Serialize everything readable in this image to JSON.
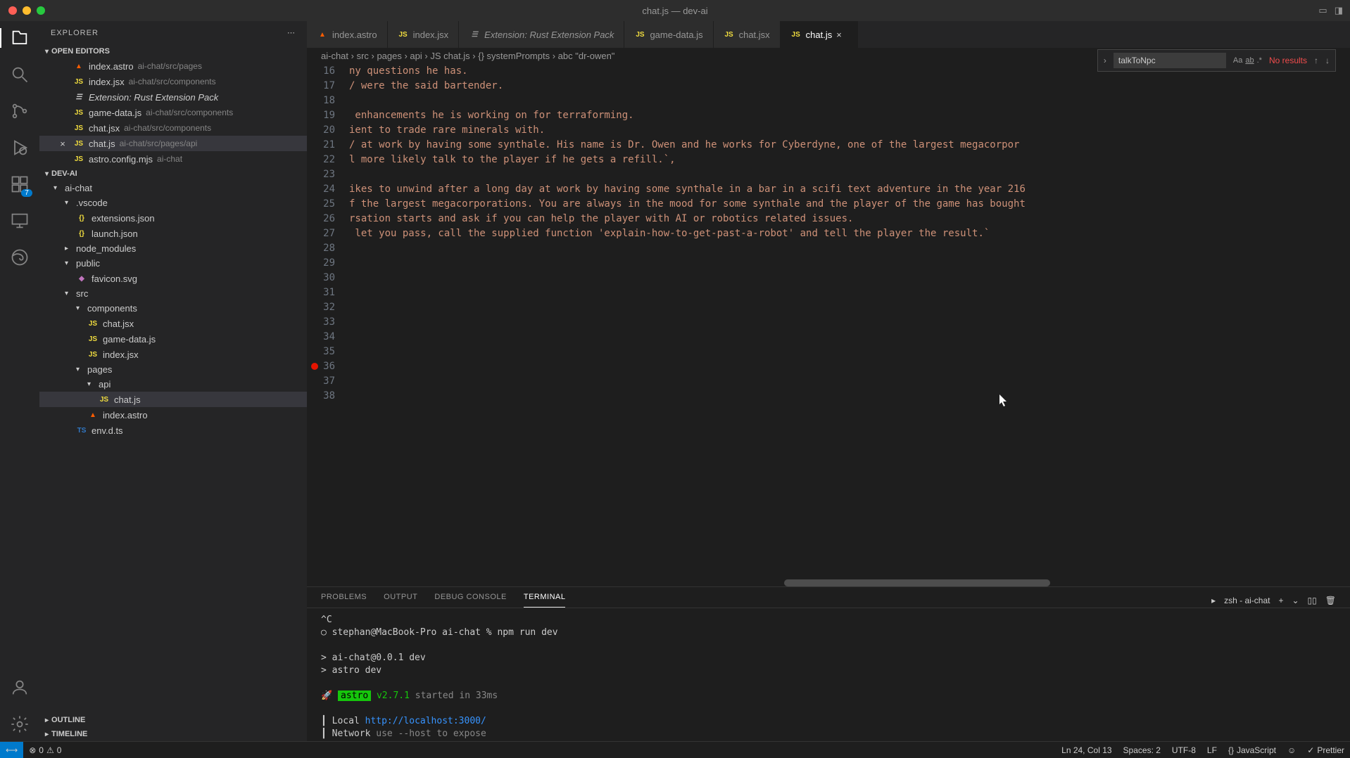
{
  "window": {
    "title": "chat.js — dev-ai"
  },
  "sidebar": {
    "title": "EXPLORER",
    "sections": {
      "openEditors": {
        "label": "OPEN EDITORS",
        "items": [
          {
            "icon": "astro",
            "name": "index.astro",
            "path": "ai-chat/src/pages"
          },
          {
            "icon": "js",
            "name": "index.jsx",
            "path": "ai-chat/src/components"
          },
          {
            "icon": "ext",
            "name": "Extension: Rust Extension Pack",
            "path": ""
          },
          {
            "icon": "js",
            "name": "game-data.js",
            "path": "ai-chat/src/components"
          },
          {
            "icon": "js",
            "name": "chat.jsx",
            "path": "ai-chat/src/components"
          },
          {
            "icon": "js",
            "name": "chat.js",
            "path": "ai-chat/src/pages/api"
          },
          {
            "icon": "js",
            "name": "astro.config.mjs",
            "path": "ai-chat"
          }
        ]
      },
      "workspace": {
        "label": "DEV-AI",
        "tree": {
          "aiChat": "ai-chat",
          "vscode": ".vscode",
          "extensionsJson": "extensions.json",
          "launchJson": "launch.json",
          "nodeModules": "node_modules",
          "public": "public",
          "faviconSvg": "favicon.svg",
          "src": "src",
          "components": "components",
          "chatJsx": "chat.jsx",
          "gameDataJs": "game-data.js",
          "indexJsx": "index.jsx",
          "pages": "pages",
          "api": "api",
          "chatJs": "chat.js",
          "indexAstro": "index.astro",
          "envDts": "env.d.ts"
        }
      },
      "outline": "OUTLINE",
      "timeline": "TIMELINE"
    }
  },
  "activityBadge": "7",
  "tabs": [
    {
      "icon": "astro",
      "label": "index.astro"
    },
    {
      "icon": "js",
      "label": "index.jsx"
    },
    {
      "icon": "ext",
      "label": "Extension: Rust Extension Pack",
      "italic": true
    },
    {
      "icon": "js",
      "label": "game-data.js"
    },
    {
      "icon": "js",
      "label": "chat.jsx"
    },
    {
      "icon": "js",
      "label": "chat.js",
      "active": true
    }
  ],
  "breadcrumbs": "ai-chat › src › pages › api › JS chat.js › {} systemPrompts › abc \"dr-owen\"",
  "find": {
    "value": "talkToNpc",
    "result": "No results"
  },
  "code": {
    "startLine": 16,
    "breakpointLine": 36,
    "lines": [
      "ny questions he has.",
      "/ were the said bartender.",
      "",
      " enhancements he is working on for terraforming.",
      "ient to trade rare minerals with.",
      "/ at work by having some synthale. His name is Dr. Owen and he works for Cyberdyne, one of the largest megacorpor",
      "l more likely talk to the player if he gets a refill.`,",
      "",
      "ikes to unwind after a long day at work by having some synthale in a bar in a scifi text adventure in the year 216",
      "f the largest megacorporations. You are always in the mood for some synthale and the player of the game has bought",
      "rsation starts and ask if you can help the player with AI or robotics related issues.",
      " let you pass, call the supplied function 'explain-how-to-get-past-a-robot' and tell the player the result.`",
      "",
      "",
      "",
      "",
      "",
      "",
      "",
      "",
      "",
      "",
      ""
    ]
  },
  "panel": {
    "tabs": {
      "problems": "PROBLEMS",
      "output": "OUTPUT",
      "debugConsole": "DEBUG CONSOLE",
      "terminal": "TERMINAL"
    },
    "terminalLabel": "zsh - ai-chat",
    "terminal": [
      {
        "text": "^C"
      },
      {
        "text": "○ stephan@MacBook-Pro ai-chat % npm run dev"
      },
      {
        "text": ""
      },
      {
        "text": "> ai-chat@0.0.1 dev"
      },
      {
        "text": "> astro dev"
      },
      {
        "text": ""
      },
      {
        "html": "🚀 <span class='term-green'>astro</span> <span class='term-greentext'>v2.7.1</span> <span class='term-dim'>started in 33ms</span>"
      },
      {
        "text": ""
      },
      {
        "html": "  ┃ Local    <span class='term-blue'>http://localhost:3000/</span>"
      },
      {
        "html": "  ┃ Network  <span class='term-dim'>use --host to expose</span>"
      }
    ]
  },
  "statusbar": {
    "errors": "0",
    "warnings": "0",
    "cursor": "Ln 24, Col 13",
    "spaces": "Spaces: 2",
    "encoding": "UTF-8",
    "eol": "LF",
    "language": "JavaScript",
    "prettier": "Prettier"
  }
}
